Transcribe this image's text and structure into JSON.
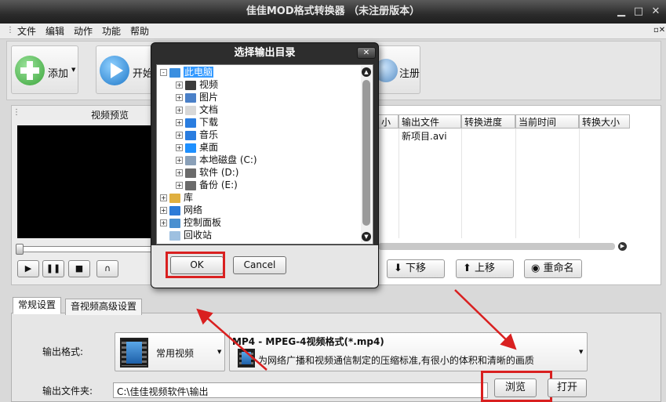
{
  "window": {
    "title": "佳佳MOD格式转换器  （未注册版本）",
    "minimize": "▁",
    "maximize": "□",
    "close": "✕"
  },
  "menu": [
    "文件",
    "编辑",
    "动作",
    "功能",
    "帮助"
  ],
  "toolbar": {
    "add_label": "添加",
    "start_label": "开始",
    "register_label": "注册"
  },
  "preview": {
    "title": "视频预览"
  },
  "file_table": {
    "columns": [
      "小",
      "输出文件",
      "转换进度",
      "当前时间",
      "转换大小"
    ],
    "rows": [
      {
        "output_file": "新项目.avi"
      }
    ]
  },
  "list_buttons": {
    "move_down": "下移",
    "move_up": "上移",
    "rename": "重命名"
  },
  "settings": {
    "tabs": [
      "常规设置",
      "音视频高级设置"
    ],
    "output_format_label": "输出格式:",
    "format_category": "常用视频",
    "format_name": "MP4 - MPEG-4视频格式(*.mp4)",
    "format_desc": "为网络广播和视频通信制定的压缩标准,有很小的体积和清晰的画质",
    "output_folder_label": "输出文件夹:",
    "output_folder_value": "C:\\佳佳视频软件\\输出",
    "browse_label": "浏览",
    "open_label": "打开"
  },
  "dialog": {
    "title": "选择输出目录",
    "tree": [
      {
        "label": "此电脑",
        "level": 0,
        "expander": "-",
        "icon": "computer-icon",
        "selected": true
      },
      {
        "label": "视频",
        "level": 1,
        "expander": "+",
        "icon": "video-folder-icon"
      },
      {
        "label": "图片",
        "level": 1,
        "expander": "+",
        "icon": "pictures-folder-icon"
      },
      {
        "label": "文档",
        "level": 1,
        "expander": "+",
        "icon": "documents-folder-icon"
      },
      {
        "label": "下载",
        "level": 1,
        "expander": "+",
        "icon": "download-folder-icon"
      },
      {
        "label": "音乐",
        "level": 1,
        "expander": "+",
        "icon": "music-folder-icon"
      },
      {
        "label": "桌面",
        "level": 1,
        "expander": "+",
        "icon": "desktop-folder-icon"
      },
      {
        "label": "本地磁盘 (C:)",
        "level": 1,
        "expander": "+",
        "icon": "system-drive-icon"
      },
      {
        "label": "软件 (D:)",
        "level": 1,
        "expander": "+",
        "icon": "drive-icon"
      },
      {
        "label": "备份 (E:)",
        "level": 1,
        "expander": "+",
        "icon": "drive-icon"
      },
      {
        "label": "库",
        "level": 0,
        "expander": "+",
        "icon": "library-icon"
      },
      {
        "label": "网络",
        "level": 0,
        "expander": "+",
        "icon": "network-icon"
      },
      {
        "label": "控制面板",
        "level": 0,
        "expander": "+",
        "icon": "control-panel-icon"
      },
      {
        "label": "回收站",
        "level": 0,
        "expander": "",
        "icon": "recycle-bin-icon"
      }
    ],
    "ok_label": "OK",
    "cancel_label": "Cancel"
  },
  "colors": {
    "title_bar": "#2c2c2c",
    "highlight": "#d92020",
    "selection": "#3399ff",
    "add_icon": "#45b045",
    "start_icon": "#2a8ad8"
  }
}
